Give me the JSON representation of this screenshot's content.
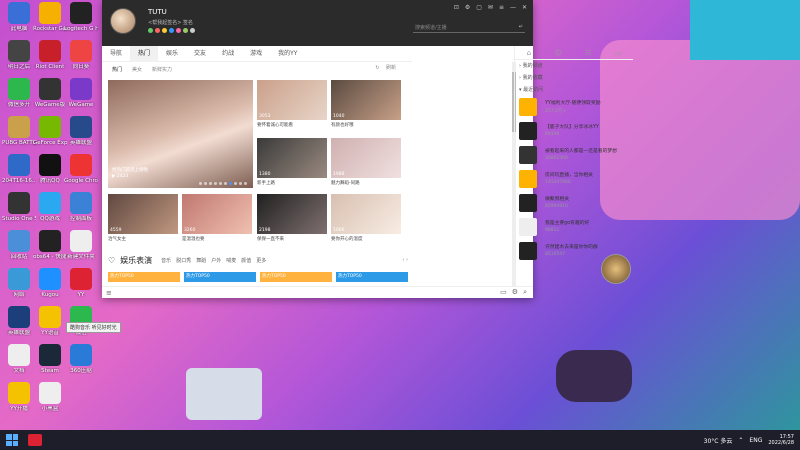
{
  "desktop": {
    "icons": [
      {
        "label": "此电脑",
        "color": "#3a6fd8"
      },
      {
        "label": "Rockstar Games...",
        "color": "#f6b000"
      },
      {
        "label": "Logitech G HUB",
        "color": "#222"
      },
      {
        "label": "明日之后",
        "color": "#444"
      },
      {
        "label": "Riot Client",
        "color": "#c8202a"
      },
      {
        "label": "向日葵",
        "color": "#e44"
      },
      {
        "label": "微信多开",
        "color": "#2db84d"
      },
      {
        "label": "WeGame版",
        "color": "#333"
      },
      {
        "label": "WeGame",
        "color": "#7a39c9"
      },
      {
        "label": "PUBG BATTLEGR...",
        "color": "#caa04a"
      },
      {
        "label": "GeForce Experience",
        "color": "#76b900"
      },
      {
        "label": "英雄联盟",
        "color": "#274a8a"
      },
      {
        "label": "204T16-16...",
        "color": "#2f6ac8"
      },
      {
        "label": "腾讯QQ",
        "color": "#111"
      },
      {
        "label": "Google Chrome",
        "color": "#e33"
      },
      {
        "label": "Studio One 5",
        "color": "#333"
      },
      {
        "label": "QQ游戏",
        "color": "#2aa8f0"
      },
      {
        "label": "控制面板",
        "color": "#3b82d6"
      },
      {
        "label": "回收站",
        "color": "#4a8fd8"
      },
      {
        "label": "obs64 - 快捷方式",
        "color": "#222"
      },
      {
        "label": "新建文件夹",
        "color": "#eee"
      },
      {
        "label": "网络",
        "color": "#3a9ad8"
      },
      {
        "label": "Kugou",
        "color": "#1e90ff"
      },
      {
        "label": "YY",
        "color": "#d23"
      },
      {
        "label": "英雄联盟",
        "color": "#1c3e7a"
      },
      {
        "label": "YY语音",
        "color": "#f4c200"
      },
      {
        "label": "微信",
        "color": "#2db84d"
      },
      {
        "label": "文档",
        "color": "#eee"
      },
      {
        "label": "Steam",
        "color": "#1b2838"
      },
      {
        "label": "360压缩",
        "color": "#2a7bd8"
      },
      {
        "label": "YY开播",
        "color": "#f4c200"
      },
      {
        "label": "小黑盒",
        "color": "#eee"
      }
    ],
    "tooltip": "酷狗音乐 听见好时光"
  },
  "taskbar": {
    "weather": "30°C 多云",
    "lang": "ENG",
    "time": "17:57",
    "date": "2022/6/28"
  },
  "window": {
    "user": {
      "name": "TUTU",
      "sub": "<帮我起签名> 签名",
      "badges": 7
    },
    "controls": [
      "⊡",
      "⚙",
      "▢",
      "✉",
      "≡",
      "—",
      "✕"
    ],
    "search_placeholder": "搜索频道/主播",
    "nav_tabs": [
      "导航",
      "热门",
      "娱乐",
      "交友",
      "约战",
      "游戏",
      "我的YY"
    ],
    "active_tab": 1,
    "sub_tabs": [
      "热门",
      "美女",
      "新鲜实力"
    ],
    "refresh_label": "刷新",
    "hero": {
      "caption": "抢热门首页上榜啦",
      "views": "2423"
    },
    "cards": [
      {
        "cap": "要怀着诚心可能看",
        "views": "3053",
        "c1": "#caa08a",
        "c2": "#e8d4c8"
      },
      {
        "cap": "有颜也好哦",
        "views": "1040",
        "c1": "#5a4a40",
        "c2": "#c8a088"
      },
      {
        "cap": "新手上路",
        "views": "1380",
        "c1": "#3a3a3a",
        "c2": "#9a8a80"
      },
      {
        "cap": "魅力舞蹈-同路",
        "views": "1988",
        "c1": "#d0b0b0",
        "c2": "#f0e0e0"
      },
      {
        "cap": "治气女主",
        "views": "4559",
        "c1": "#604840",
        "c2": "#c09880"
      },
      {
        "cap": "是温温也要",
        "views": "3260",
        "c1": "#c07870",
        "c2": "#f0c0b0"
      },
      {
        "cap": "保保一直不来",
        "views": "2198",
        "c1": "#202020",
        "c2": "#807070"
      },
      {
        "cap": "要你开心的温度",
        "views": "1066",
        "c1": "#d8c0b0",
        "c2": "#f8ece4"
      }
    ],
    "section": {
      "title": "娱乐表演",
      "links": [
        "音乐",
        "脱口秀",
        "舞蹈",
        "户外",
        "喊麦",
        "颜值",
        "更多"
      ]
    },
    "strip": [
      "热力TOP50",
      "热力TOP50",
      "热力TOP50",
      "热力TOP50"
    ],
    "side": {
      "headers": [
        "我的频道",
        "我的收藏",
        "最近访问"
      ],
      "items": [
        {
          "t1": "YY福利大厅-随便领取奖励",
          "t2": "257,5万+",
          "color": "#ffb300"
        },
        {
          "t1": "【鹿子大队】分享冰冰YY",
          "t2": "69196",
          "color": "#222"
        },
        {
          "t1": "被看起来的人都是一还是看的梦想",
          "t2": "36862360",
          "color": "#333"
        },
        {
          "t1": "房间玩直播，当你相关",
          "t2": "145447466",
          "color": "#ffb300"
        },
        {
          "t1": "做聚频相关",
          "t2": "82994910",
          "color": "#222"
        },
        {
          "t1": "我是主要go有趣的好",
          "t2": "98811",
          "color": "#eee"
        },
        {
          "t1": "许然建木去来是你你的群",
          "t2": "8510547",
          "color": "#222"
        }
      ]
    }
  }
}
